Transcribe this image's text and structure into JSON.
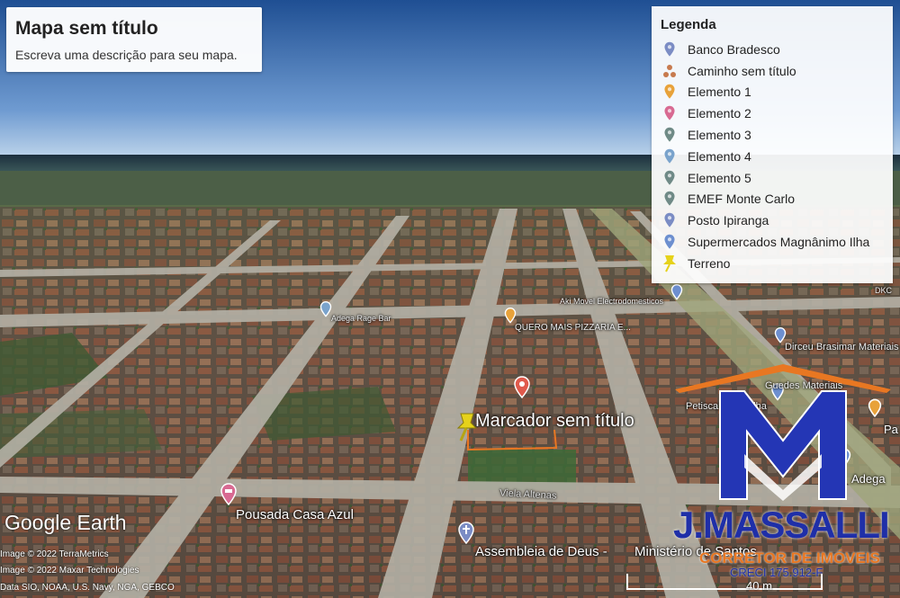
{
  "map": {
    "title": "Mapa sem título",
    "description": "Escreva uma descrição para seu mapa."
  },
  "legend": {
    "title": "Legenda",
    "items": [
      {
        "label": "Banco Bradesco",
        "icon": "pin-icon",
        "color": "#7b8cc4"
      },
      {
        "label": "Caminho sem título",
        "icon": "path-icon",
        "color": "#c77a4e"
      },
      {
        "label": "Elemento 1",
        "icon": "pin-icon",
        "color": "#e8a23a"
      },
      {
        "label": "Elemento 2",
        "icon": "pin-icon",
        "color": "#d86a92"
      },
      {
        "label": "Elemento 3",
        "icon": "pin-icon",
        "color": "#6f8a86"
      },
      {
        "label": "Elemento 4",
        "icon": "pin-icon",
        "color": "#7aa3cc"
      },
      {
        "label": "Elemento 5",
        "icon": "pin-icon",
        "color": "#6f8a86"
      },
      {
        "label": "EMEF Monte Carlo",
        "icon": "pin-icon",
        "color": "#6f8a86"
      },
      {
        "label": "Posto Ipiranga",
        "icon": "pin-icon",
        "color": "#7b8cc4"
      },
      {
        "label": "Supermercados Magnânimo Ilha",
        "icon": "pin-icon",
        "color": "#6d8fcf"
      },
      {
        "label": "Terreno",
        "icon": "pushpin-icon",
        "color": "#e6d21a"
      }
    ]
  },
  "places": {
    "marker": "Marcador sem título",
    "pousada": "Pousada Casa Azul",
    "assembleia": "Assembleia de Deus -",
    "ministerio": "Ministério de Santos",
    "viela": "Viela Altenas",
    "pizzaria": "QUERO MAIS PIZZARIA E...",
    "adega_left": "Adega Rage Bar",
    "movel": "Aki Movel Electrodomesticos",
    "dirceu": "Dirceu Brasimar Materiais",
    "guedes": "Guedes Materiais",
    "petiscaria": "Petiscaria Ilha Ilha",
    "adega_right": "Adega",
    "pa": "Pa",
    "dkc": "DKC"
  },
  "branding": {
    "name": "J.MASSALLI",
    "subtitle": "CORRETOR DE IMÓVEIS",
    "creci": "CRECI 175.912-F"
  },
  "footer": {
    "logo": "Google Earth",
    "credits": [
      "Image © 2022 TerraMetrics",
      "Image © 2022 Maxar Technologies",
      "Data SIO, NOAA, U.S. Navy, NGA, GEBCO"
    ],
    "scale": "40 m"
  }
}
